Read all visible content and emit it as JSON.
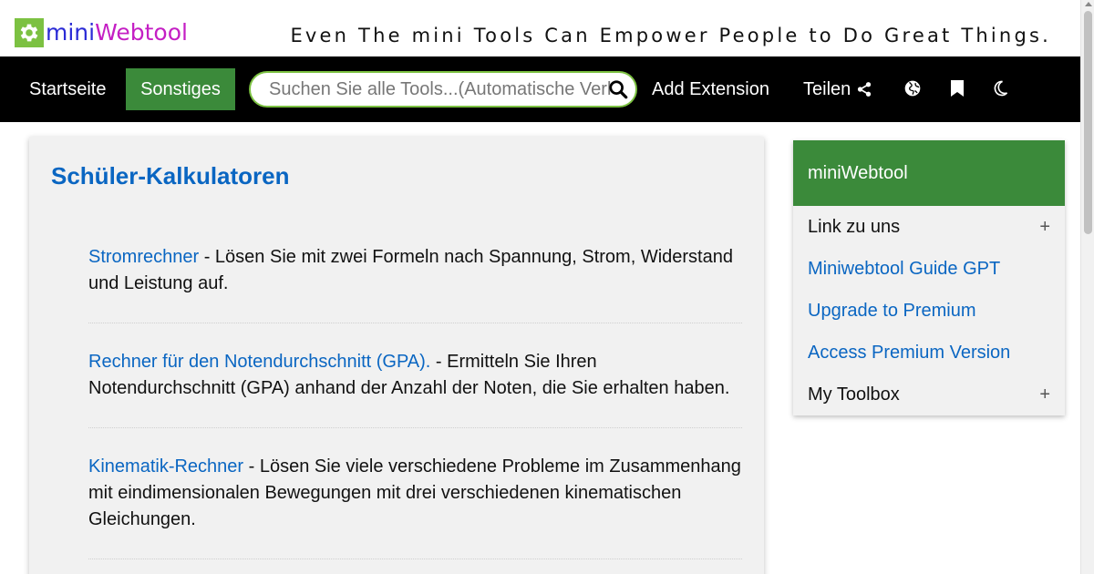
{
  "header": {
    "logo_mini": "mini",
    "logo_web": "Webtool",
    "slogan": "Even The mini Tools Can Empower People to Do Great Things."
  },
  "nav": {
    "home": "Startseite",
    "active": "Sonstiges",
    "search_placeholder": "Suchen Sie alle Tools...(Automatische Verlinkung)",
    "extension": "Add Extension",
    "share": "Teilen"
  },
  "main": {
    "title": "Schüler-Kalkulatoren",
    "tools": [
      {
        "name": "Stromrechner",
        "desc": " - Lösen Sie mit zwei Formeln nach Spannung, Strom, Widerstand und Leistung auf."
      },
      {
        "name": "Rechner für den Notendurchschnitt (GPA).",
        "desc": " - Ermitteln Sie Ihren Notendurchschnitt (GPA) anhand der Anzahl der Noten, die Sie erhalten haben."
      },
      {
        "name": "Kinematik-Rechner",
        "desc": " - Lösen Sie viele verschiedene Probleme im Zusammenhang mit eindimensionalen Bewegungen mit drei verschiedenen kinematischen Gleichungen."
      }
    ]
  },
  "sidebar": {
    "title": "miniWebtool",
    "items": [
      {
        "label": "Link zu uns",
        "expand": "+"
      },
      {
        "label": "Miniwebtool Guide GPT"
      },
      {
        "label": "Upgrade to Premium"
      },
      {
        "label": "Access Premium Version"
      },
      {
        "label": "My Toolbox",
        "expand": "+"
      }
    ]
  },
  "colors": {
    "brand_green": "#3b8a3a",
    "link_blue": "#0a66c2",
    "logo_mini": "#2b2bd6",
    "logo_web": "#c41fc4"
  }
}
